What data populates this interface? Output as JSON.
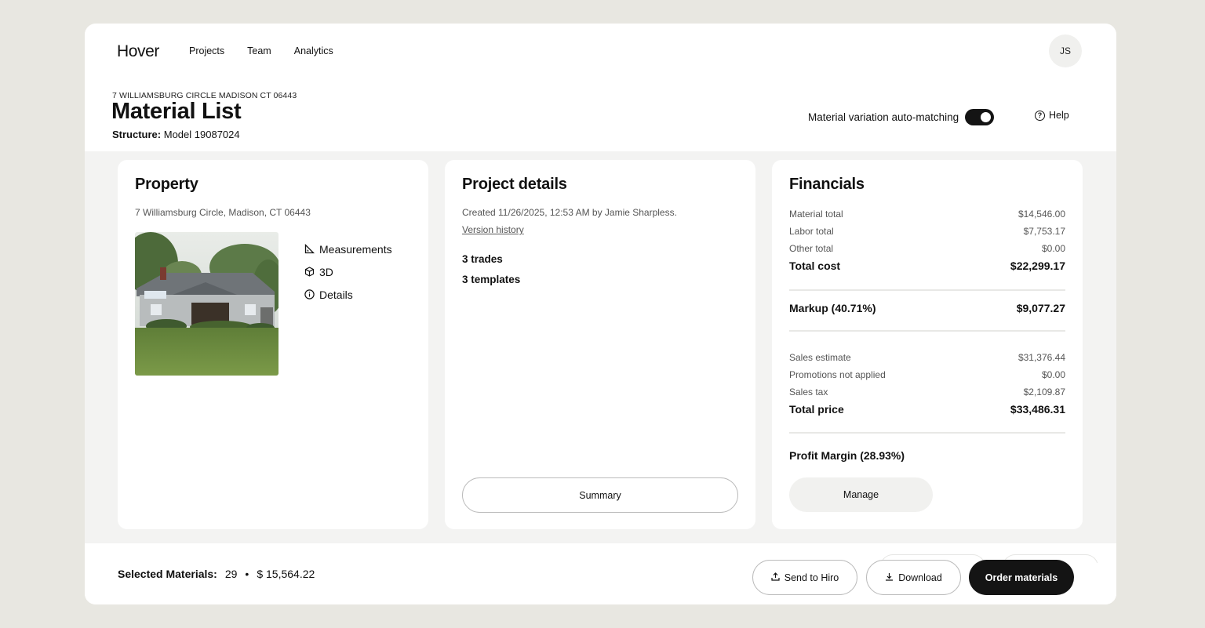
{
  "app": {
    "logo": "Hover"
  },
  "nav": {
    "items": [
      {
        "label": "Projects"
      },
      {
        "label": "Team"
      },
      {
        "label": "Analytics"
      }
    ]
  },
  "user": {
    "initials": "JS"
  },
  "header": {
    "address": "7 WILLIAMSBURG CIRCLE MADISON CT 06443",
    "title": "Material List",
    "structure_label": "Structure:",
    "structure_value": "Model 19087024",
    "automatch_label": "Material variation auto-matching",
    "automatch_on": true,
    "help_label": "Help"
  },
  "property": {
    "title": "Property",
    "address": "7 Williamsburg Circle, Madison, CT 06443",
    "links": [
      {
        "label": "Measurements",
        "icon": "ruler-icon"
      },
      {
        "label": "3D",
        "icon": "cube-icon"
      },
      {
        "label": "Details",
        "icon": "info-icon"
      }
    ]
  },
  "project": {
    "title": "Project details",
    "created": "Created 11/26/2025, 12:53 AM by Jamie Sharpless.",
    "version_history": "Version history",
    "trades": "3 trades",
    "templates": "3 templates",
    "summary_label": "Summary"
  },
  "financials": {
    "title": "Financials",
    "rows1": [
      {
        "label": "Material total",
        "value": "$14,546.00"
      },
      {
        "label": "Labor total",
        "value": "$7,753.17"
      },
      {
        "label": "Other total",
        "value": "$0.00"
      }
    ],
    "total_cost": {
      "label": "Total cost",
      "value": "$22,299.17"
    },
    "markup": {
      "label": "Markup (40.71%)",
      "value": "$9,077.27"
    },
    "rows2": [
      {
        "label": "Sales estimate",
        "value": "$31,376.44"
      },
      {
        "label": "Promotions not applied",
        "value": "$0.00"
      },
      {
        "label": "Sales tax",
        "value": "$2,109.87"
      }
    ],
    "total_price": {
      "label": "Total price",
      "value": "$33,486.31"
    },
    "profit_margin": "Profit Margin (28.93%)",
    "manage_label": "Manage"
  },
  "bottom": {
    "selected_label": "Selected Materials:",
    "selected_count": "29",
    "separator": "•",
    "selected_amount": "$ 15,564.22",
    "send_label": "Send to Hiro",
    "download_label": "Download",
    "order_label": "Order materials"
  }
}
